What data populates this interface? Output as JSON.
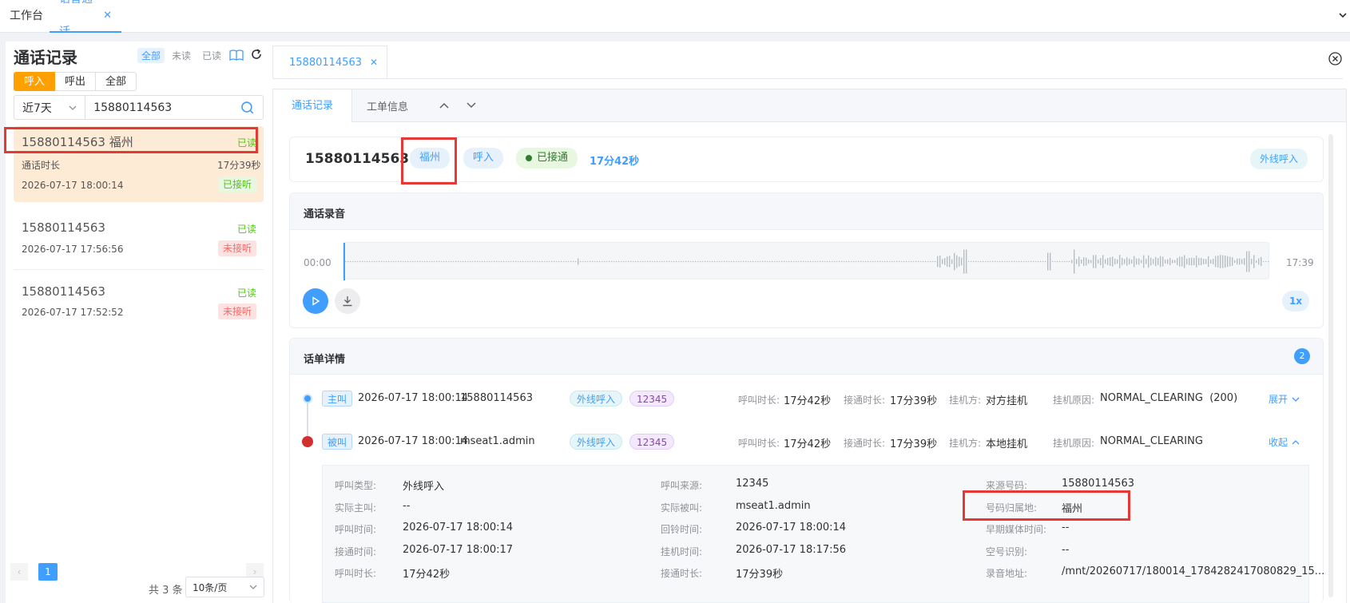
{
  "tabs": {
    "workbench": "工作台",
    "voice": "语音通话"
  },
  "sidebar": {
    "title": "通话记录",
    "filters": [
      "全部",
      "未读",
      "已读"
    ],
    "dir": [
      "呼入",
      "呼出",
      "全部"
    ],
    "range": "近7天",
    "search": "15880114563",
    "items": [
      {
        "title": "15880114563 福州",
        "read": "已读",
        "dur_label": "通话时长",
        "dur": "17分39秒",
        "time": "2026-07-17 18:00:14",
        "status": "已接听"
      },
      {
        "title": "15880114563",
        "read": "已读",
        "time": "2026-07-17 17:56:56",
        "status": "未接听"
      },
      {
        "title": "15880114563",
        "read": "已读",
        "time": "2026-07-17 17:52:52",
        "status": "未接听"
      }
    ],
    "page": "1",
    "total": "共 3 条",
    "pagesize": "10条/页"
  },
  "detail": {
    "tab": "15880114563",
    "subtabs": [
      "通话记录",
      "工单信息"
    ],
    "number": "15880114563",
    "city": "福州",
    "direction": "呼入",
    "connected": "已接通",
    "duration": "17分42秒",
    "call_type": "外线呼入",
    "rec_title": "通话录音",
    "rec_start": "00:00",
    "rec_end": "17:39",
    "speed": "1x",
    "cdr_title": "话单详情",
    "cdr_count": "2",
    "legs": [
      {
        "role": "主叫",
        "time": "2026-07-17 18:00:14",
        "party": "15880114563",
        "type": "外线呼入",
        "src": "12345",
        "ring_label": "呼叫时长:",
        "ring": "17分42秒",
        "conn_label": "接通时长:",
        "conn": "17分39秒",
        "hang_label": "挂机方:",
        "hang": "对方挂机",
        "reason_label": "挂机原因:",
        "reason": "NORMAL_CLEARING  (200)",
        "action": "展开"
      },
      {
        "role": "被叫",
        "time": "2026-07-17 18:00:14",
        "party": "mseat1.admin",
        "type": "外线呼入",
        "src": "12345",
        "ring_label": "呼叫时长:",
        "ring": "17分42秒",
        "conn_label": "接通时长:",
        "conn": "17分39秒",
        "hang_label": "挂机方:",
        "hang": "本地挂机",
        "reason_label": "挂机原因:",
        "reason": "NORMAL_CLEARING",
        "action": "收起"
      }
    ],
    "info": [
      [
        [
          "呼叫类型:",
          "外线呼入"
        ],
        [
          "呼叫来源:",
          "12345"
        ],
        [
          "来源号码:",
          "15880114563"
        ]
      ],
      [
        [
          "实际主叫:",
          "--"
        ],
        [
          "实际被叫:",
          "mseat1.admin"
        ],
        [
          "号码归属地:",
          "福州"
        ]
      ],
      [
        [
          "呼叫时间:",
          "2026-07-17 18:00:14"
        ],
        [
          "回铃时间:",
          "2026-07-17 18:00:14"
        ],
        [
          "早期媒体时间:",
          "--"
        ]
      ],
      [
        [
          "接通时间:",
          "2026-07-17 18:00:17"
        ],
        [
          "挂机时间:",
          "2026-07-17 18:17:56"
        ],
        [
          "空号识别:",
          "--"
        ]
      ],
      [
        [
          "呼叫时长:",
          "17分42秒"
        ],
        [
          "接通时长:",
          "17分39秒"
        ],
        [
          "录音地址:",
          "/mnt/20260717/180014_1784282417080829_15..."
        ]
      ]
    ]
  },
  "colors": {
    "accent": "#409eff",
    "orange": "#ff9f00",
    "green": "#52c41a",
    "red": "#f56c6c",
    "highlight": "#e53935"
  }
}
